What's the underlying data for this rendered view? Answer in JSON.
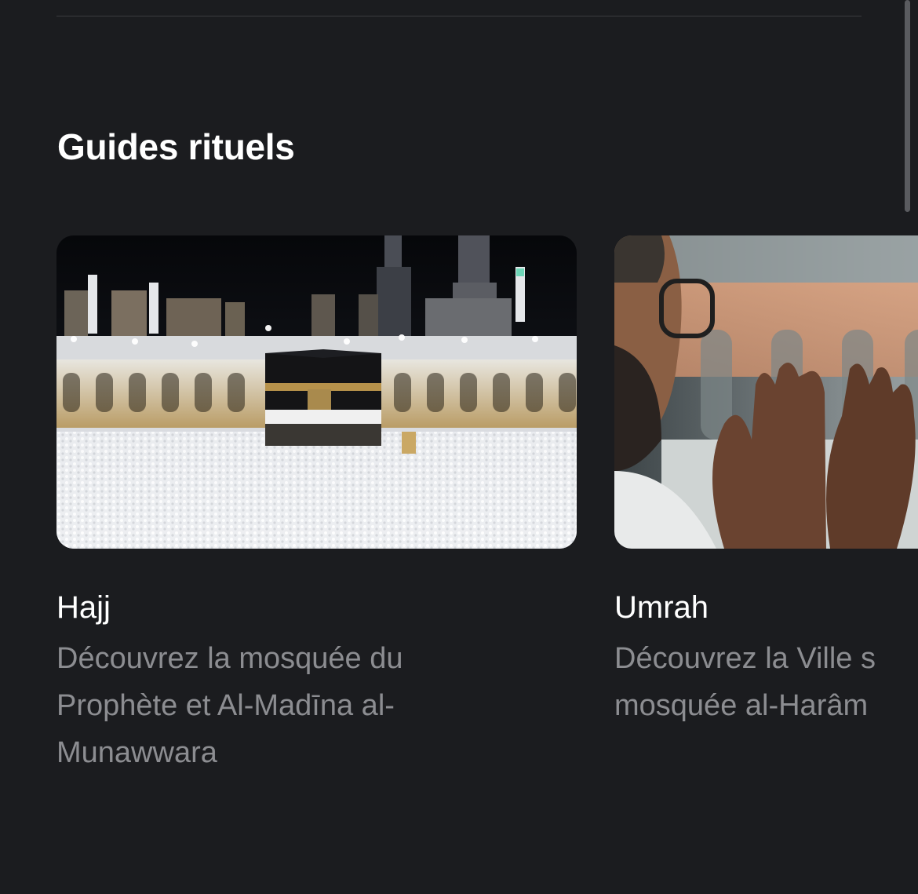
{
  "section": {
    "title": "Guides rituels"
  },
  "cards": [
    {
      "title": "Hajj",
      "description": "Découvrez la mosquée du Prophète et Al-Madīna al-Munawwara",
      "image_icon": "kaaba-photo"
    },
    {
      "title": "Umrah",
      "description_line1": "Découvrez la Ville s",
      "description_line2": "mosquée al-Harâm",
      "image_icon": "praying-hands-photo"
    }
  ],
  "colors": {
    "background": "#1b1c1f",
    "title": "#ffffff",
    "description": "#8c8d91",
    "divider": "#3a3b3f"
  }
}
